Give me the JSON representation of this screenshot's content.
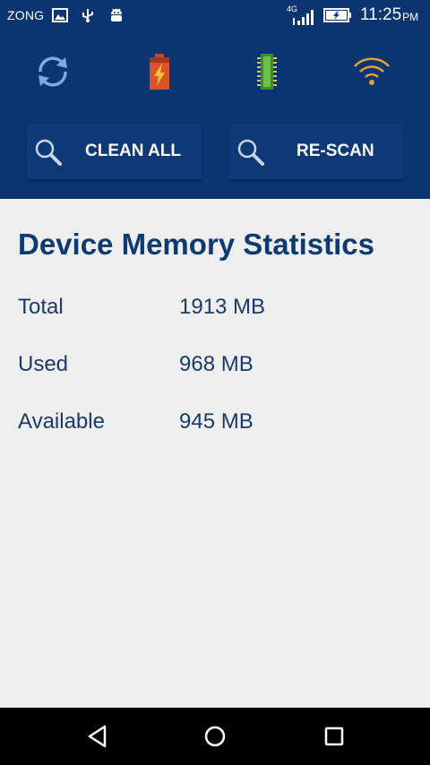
{
  "status_bar": {
    "carrier": "ZONG",
    "network_type": "4G",
    "time": "11:25",
    "ampm": "PM",
    "icons": [
      "gallery-icon",
      "usb-icon",
      "android-icon",
      "signal-icon",
      "battery-charging-icon"
    ]
  },
  "toolbar": {
    "icons": [
      "refresh-icon",
      "battery-boost-icon",
      "ram-icon",
      "wifi-icon"
    ],
    "colors": {
      "refresh": "#7fa8e0",
      "battery": "#d9532b",
      "ram": "#5aaa3c",
      "wifi": "#e0a23a"
    }
  },
  "actions": {
    "clean_all_label": "CLEAN ALL",
    "rescan_label": "RE-SCAN"
  },
  "stats": {
    "title": "Device Memory Statistics",
    "rows": [
      {
        "label": "Total",
        "value": "1913 MB"
      },
      {
        "label": "Used",
        "value": "968 MB"
      },
      {
        "label": "Available",
        "value": "945 MB"
      }
    ]
  },
  "nav": {
    "icons": [
      "back-icon",
      "home-icon",
      "recents-icon"
    ]
  },
  "colors": {
    "header_bg": "#0a3570",
    "title_color": "#0e3a73",
    "page_bg": "#efefef"
  }
}
